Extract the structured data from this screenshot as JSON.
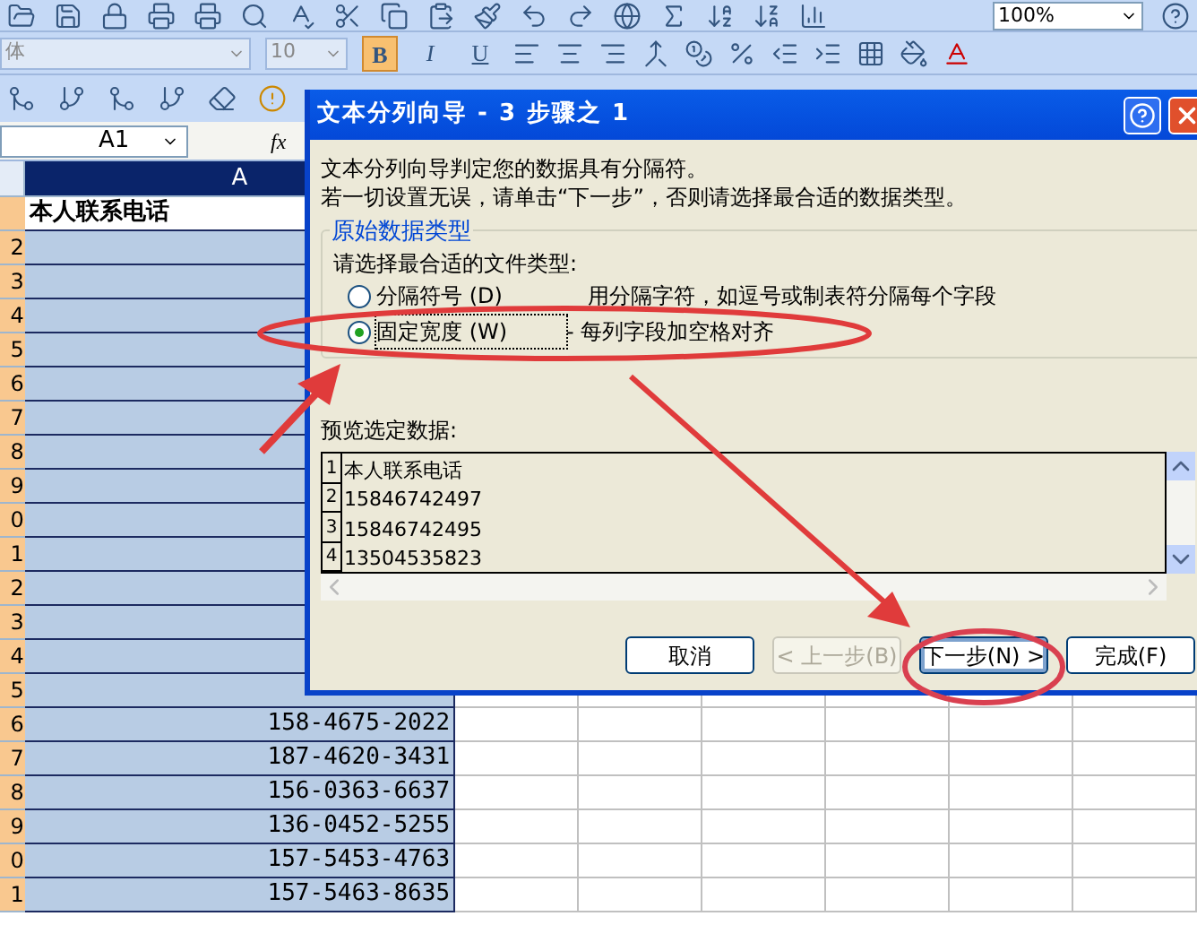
{
  "toolbar_standard": {
    "zoom": "100%"
  },
  "toolbar_formatting": {
    "font": "体",
    "size": "10",
    "style_buttons": [
      {
        "label": "B",
        "kind": "bold",
        "selected": true
      },
      {
        "label": "I",
        "kind": "italic",
        "selected": false
      },
      {
        "label": "U",
        "kind": "underline",
        "selected": false
      }
    ]
  },
  "formula_bar": {
    "name_box": "A1",
    "function_label": "fx"
  },
  "sheet": {
    "columns": [
      {
        "label": "A",
        "selected": true
      }
    ],
    "rows": [
      {
        "value": "本人联系电话",
        "bold": true
      },
      {
        "header": "2"
      },
      {
        "header": "3"
      },
      {
        "header": "4"
      },
      {
        "header": "5"
      },
      {
        "header": "6"
      },
      {
        "header": "7"
      },
      {
        "header": "8"
      },
      {
        "header": "9"
      },
      {
        "header": "0"
      },
      {
        "header": "1"
      },
      {
        "header": "2"
      },
      {
        "header": "3"
      },
      {
        "header": "4"
      },
      {
        "header": "5"
      },
      {
        "header": "6",
        "value": "158-4675-2022"
      },
      {
        "header": "7",
        "value": "187-4620-3431"
      },
      {
        "header": "8",
        "value": "156-0363-6637"
      },
      {
        "header": "9",
        "value": "136-0452-5255"
      },
      {
        "header": "0",
        "value": "157-5453-4763"
      },
      {
        "header": "1",
        "value": "157-5463-8635"
      }
    ]
  },
  "dialog": {
    "title": "文本分列向导 - 3 步骤之 1",
    "intro": [
      "文本分列向导判定您的数据具有分隔符。",
      "若一切设置无误，请单击“下一步”，否则请选择最合适的数据类型。"
    ],
    "group_title": "原始数据类型",
    "group_prompt": "请选择最合适的文件类型:",
    "options": [
      {
        "label": "分隔符号 (D)",
        "description": "用分隔字符，如逗号或制表符分隔每个字段",
        "selected": false
      },
      {
        "label": "固定宽度 (W)",
        "description": "- 每列字段加空格对齐",
        "selected": true
      }
    ],
    "preview_label": "预览选定数据:",
    "preview_rows": [
      {
        "number": "1",
        "text": "本人联系电话"
      },
      {
        "number": "2",
        "text": "15846742497"
      },
      {
        "number": "3",
        "text": "15846742495"
      },
      {
        "number": "4",
        "text": "13504535823"
      }
    ],
    "buttons": [
      {
        "label": "取消",
        "disabled": false,
        "focused": false
      },
      {
        "label": "< 上一步(B)",
        "disabled": true,
        "focused": false
      },
      {
        "label": "下一步(N) >",
        "disabled": false,
        "focused": true
      },
      {
        "label": "完成(F)",
        "disabled": false,
        "focused": false
      }
    ]
  }
}
